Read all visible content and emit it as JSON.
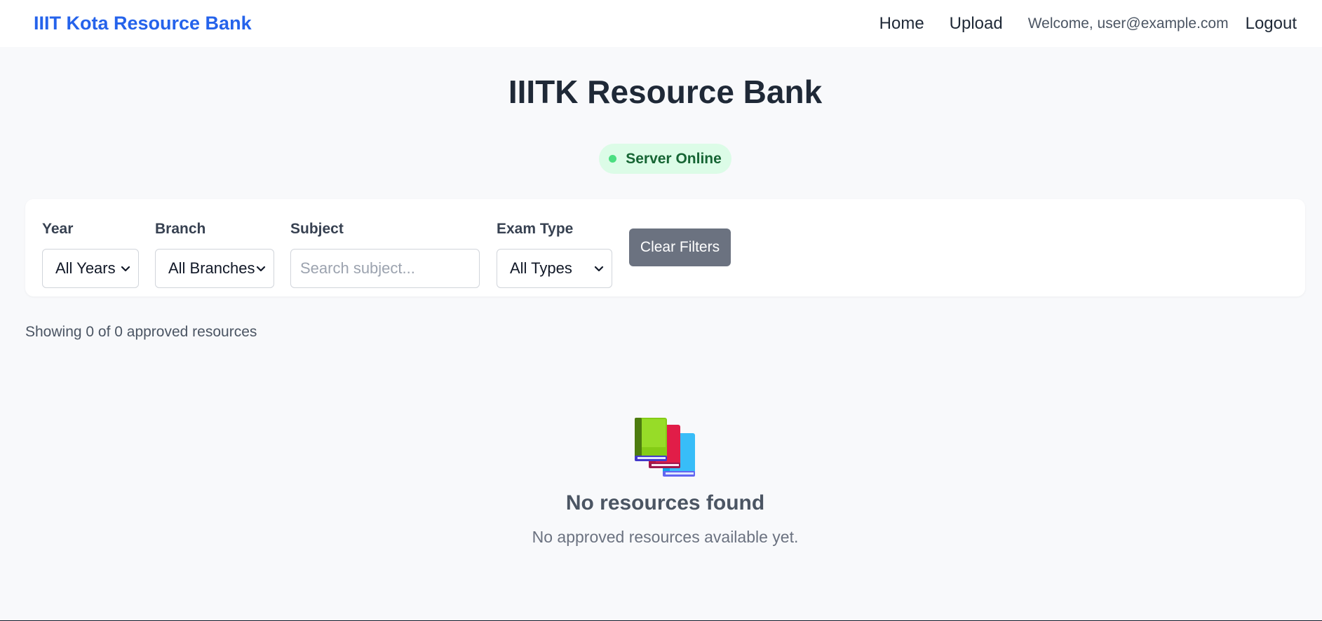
{
  "navbar": {
    "brand": "IIIT Kota Resource Bank",
    "links": {
      "home": "Home",
      "upload": "Upload"
    },
    "welcome": "Welcome, user@example.com",
    "logout": "Logout"
  },
  "page": {
    "title": "IIITK Resource Bank"
  },
  "status": {
    "text": "Server Online",
    "dot_color": "#4ade80",
    "state": "online"
  },
  "filters": {
    "year": {
      "label": "Year",
      "value": "All Years"
    },
    "branch": {
      "label": "Branch",
      "value": "All Branches"
    },
    "subject": {
      "label": "Subject",
      "value": "",
      "placeholder": "Search subject..."
    },
    "exam_type": {
      "label": "Exam Type",
      "value": "All Types"
    },
    "clear_label": "Clear Filters"
  },
  "results": {
    "count_text": "Showing 0 of 0 approved resources"
  },
  "empty_state": {
    "icon": "books-icon",
    "title": "No resources found",
    "subtitle": "No approved resources available yet."
  },
  "colors": {
    "accent": "#2563eb",
    "status_bg": "#dcfce7",
    "status_text": "#166534",
    "button_bg": "#6b7280"
  }
}
